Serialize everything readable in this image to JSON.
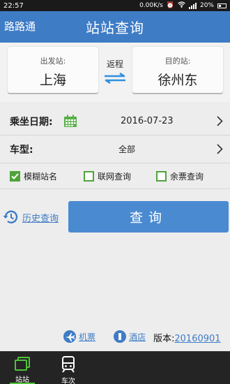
{
  "status_bar": {
    "time": "22:57",
    "speed": "0.00K/s",
    "battery": "20%"
  },
  "header": {
    "app_name": "路路通",
    "title": "站站查询"
  },
  "stations": {
    "from_label": "出发站:",
    "from_value": "上海",
    "swap_label": "返程",
    "to_label": "目的站:",
    "to_value": "徐州东"
  },
  "date_row": {
    "label": "乘坐日期:",
    "value": "2016-07-23"
  },
  "type_row": {
    "label": "车型:",
    "value": "全部"
  },
  "options": [
    {
      "label": "模糊站名",
      "checked": true
    },
    {
      "label": "联网查询",
      "checked": false
    },
    {
      "label": "余票查询",
      "checked": false
    }
  ],
  "history_label": "历史查询",
  "query_button": "查询",
  "bottom_links": {
    "flight": "机票",
    "hotel": "酒店",
    "version_label": "版本:",
    "version_value": "20160901"
  },
  "tabs": [
    {
      "label": "站站",
      "active": true
    },
    {
      "label": "车次",
      "active": false
    }
  ],
  "colors": {
    "accent": "#3e7cc5",
    "check_green": "#4fa339",
    "query_button": "#4a8ad1",
    "tabbar": "#242424"
  }
}
